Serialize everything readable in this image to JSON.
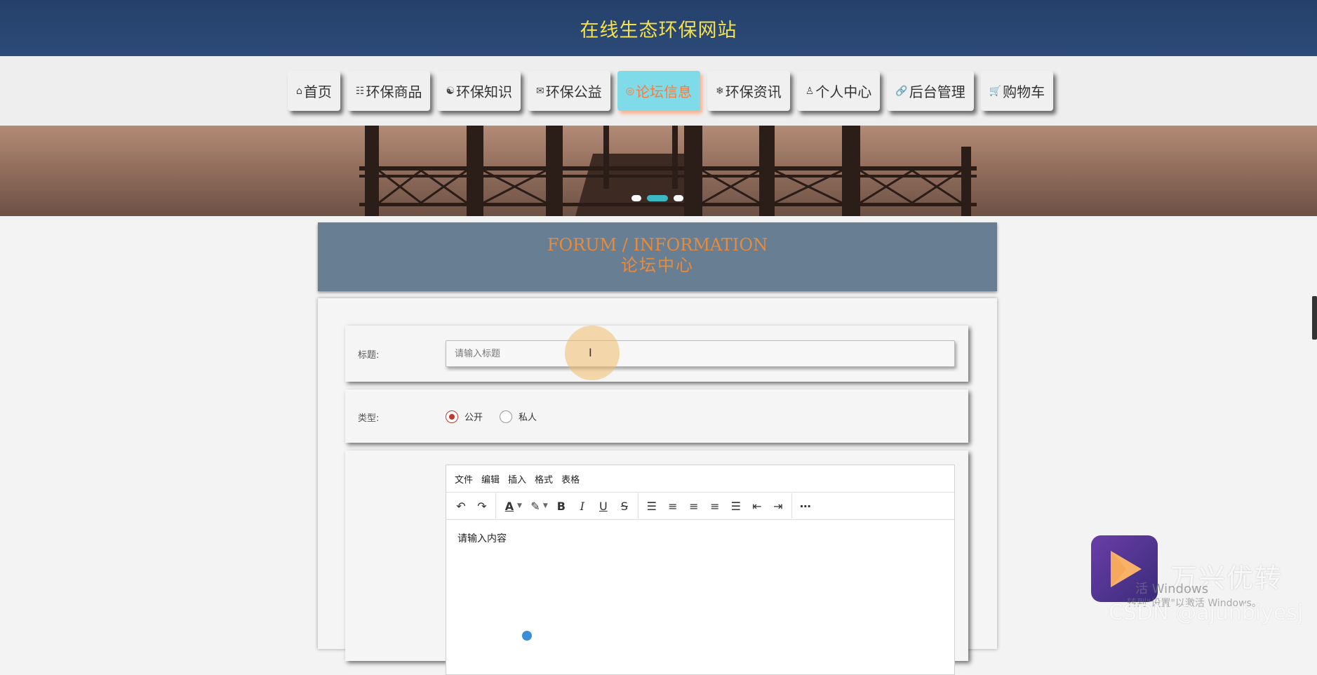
{
  "site": {
    "title": "在线生态环保网站"
  },
  "nav": {
    "items": [
      {
        "icon": "⌂",
        "icon_name": "home-icon",
        "label": "首页"
      },
      {
        "icon": "☷",
        "icon_name": "sliders-icon",
        "label": "环保商品"
      },
      {
        "icon": "☯",
        "icon_name": "knowledge-icon",
        "label": "环保知识"
      },
      {
        "icon": "✉",
        "icon_name": "mail-icon",
        "label": "环保公益"
      },
      {
        "icon": "◎",
        "icon_name": "forum-icon",
        "label": "论坛信息"
      },
      {
        "icon": "❄",
        "icon_name": "snowflake-icon",
        "label": "环保资讯"
      },
      {
        "icon": "♙",
        "icon_name": "user-icon",
        "label": "个人中心"
      },
      {
        "icon": "🔗",
        "icon_name": "link-icon",
        "label": "后台管理"
      },
      {
        "icon": "🛒",
        "icon_name": "cart-icon",
        "label": "购物车"
      }
    ],
    "active_label": "论坛信息"
  },
  "carousel": {
    "dot_count": 3,
    "active_index": 1
  },
  "section": {
    "title_en": "FORUM / INFORMATION",
    "title_cn": "论坛中心"
  },
  "form": {
    "title_label": "标题:",
    "title_value": "",
    "title_placeholder": "请输入标题",
    "type_label": "类型:",
    "type_options": [
      "公开",
      "私人"
    ],
    "type_selected": "公开"
  },
  "editor": {
    "menu": [
      "文件",
      "编辑",
      "插入",
      "格式",
      "表格"
    ],
    "placeholder": "请输入内容"
  },
  "watermark": {
    "brand": "万兴优转",
    "windows_line1": "活 Windows",
    "windows_line2": "转到\"设置\"以激活 Windows。",
    "csdn": "CSDN @ajunbiyesj"
  },
  "colors": {
    "header_bg": "#24406b",
    "site_title": "#f5e14a",
    "nav_active_bg": "#7fdbe7",
    "nav_active_text": "#ff7a3a",
    "section_bg": "#687f93",
    "section_text": "#e88a3a",
    "radio_checked": "#c0392b"
  }
}
